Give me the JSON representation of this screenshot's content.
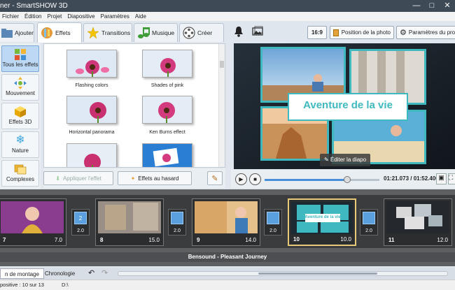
{
  "window": {
    "title": "ner - SmartSHOW 3D"
  },
  "menu": [
    "Fichier",
    "Édition",
    "Projet",
    "Diapositive",
    "Paramètres",
    "Aide"
  ],
  "tabs": [
    {
      "label": "Ajouter",
      "icon": "folder-icon"
    },
    {
      "label": "Effets",
      "icon": "effects-icon",
      "active": true
    },
    {
      "label": "Transitions",
      "icon": "star-icon"
    },
    {
      "label": "Musique",
      "icon": "music-icon"
    },
    {
      "label": "Créer",
      "icon": "film-reel-icon"
    }
  ],
  "categories": [
    {
      "label": "Tous les effets",
      "active": true
    },
    {
      "label": "Mouvement"
    },
    {
      "label": "Effets 3D"
    },
    {
      "label": "Nature"
    },
    {
      "label": "Complexes"
    }
  ],
  "effects": [
    {
      "label": "Flashing colors"
    },
    {
      "label": "Shades of pink"
    },
    {
      "label": "Horizontal panorama"
    },
    {
      "label": "Ken Burns effect"
    }
  ],
  "effect_buttons": {
    "apply": "Appliquer l'effet",
    "random": "Effets au hasard"
  },
  "toolbar": {
    "ratio": "16:9",
    "photo_position": "Position de la photo",
    "project_settings": "Paramètres du pro"
  },
  "preview": {
    "title": "Aventure de la vie",
    "edit_slide": "Éditer la diapo"
  },
  "player": {
    "time": "01:21.073 / 01:52.400",
    "progress": 0.72
  },
  "slides": [
    {
      "num": "7",
      "duration": "7.0"
    },
    {
      "num": "8",
      "duration": "15.0"
    },
    {
      "num": "9",
      "duration": "14.0"
    },
    {
      "num": "10",
      "duration": "10.0",
      "selected": true,
      "caption": "Aventure de la vie"
    },
    {
      "num": "11",
      "duration": "12.0"
    }
  ],
  "transitions": [
    {
      "label": "2",
      "duration": "2.0"
    },
    {
      "duration": "2.0"
    },
    {
      "duration": "2.0"
    },
    {
      "duration": "2.0"
    },
    {
      "duration": "2.0"
    }
  ],
  "music_track": "Bensound - Pleasant Journey",
  "bottom_tabs": {
    "storyboard": "n de montage",
    "timeline": "Chronologie"
  },
  "status": {
    "slide": "positive : 10 sur 13",
    "path": "D:\\"
  },
  "colors": {
    "accent": "#3fb8c0",
    "selected_border": "#e8c97a",
    "title_text": "#3fb8c0"
  }
}
